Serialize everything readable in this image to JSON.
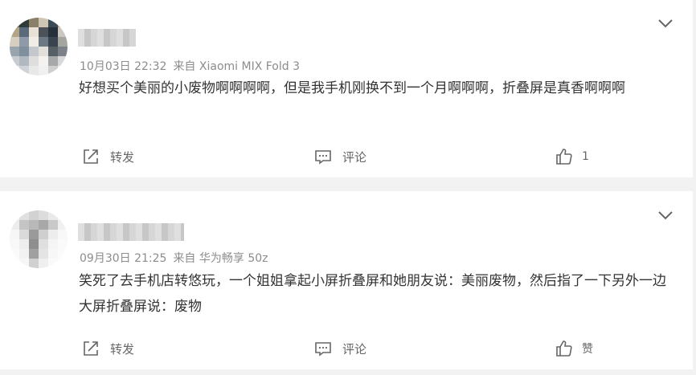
{
  "comments": [
    {
      "meta": {
        "date": "10月03日 22:32",
        "source": "来自 Xiaomi MIX Fold 3"
      },
      "text": "好想买个美丽的小废物啊啊啊啊，但是我手机刚换不到一个月啊啊啊，折叠屏是真香啊啊啊",
      "actions": {
        "share": "转发",
        "comment": "评论",
        "like": "1"
      }
    },
    {
      "meta": {
        "date": "09月30日 21:25",
        "source": "来自 华为畅享 50z"
      },
      "text": "笑死了去手机店转悠玩，一个姐姐拿起小屏折叠屏和她朋友说：美丽废物，然后指了一下另外一边大屏折叠屏说：废物",
      "actions": {
        "share": "转发",
        "comment": "评论",
        "like": "赞"
      }
    }
  ],
  "icons": {
    "share": "share-icon",
    "comment": "comment-icon",
    "like": "thumbs-up-icon",
    "more": "chevron-down-icon"
  },
  "colors": {
    "background": "#f2f2f2",
    "card": "#ffffff",
    "text": "#333333",
    "meta": "#8c8c8c",
    "action": "#666666"
  }
}
